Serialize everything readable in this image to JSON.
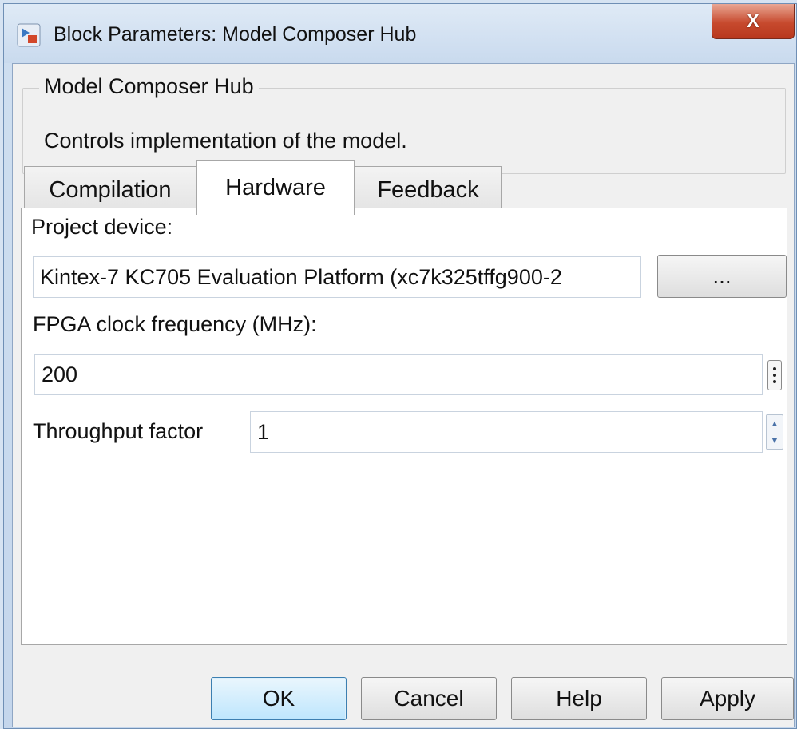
{
  "window": {
    "title": "Block Parameters: Model Composer Hub",
    "close_label": "X"
  },
  "group": {
    "legend": "Model Composer Hub",
    "description": "Controls implementation of the model."
  },
  "tabs": [
    {
      "label": "Compilation",
      "active": false
    },
    {
      "label": "Hardware",
      "active": true
    },
    {
      "label": "Feedback",
      "active": false
    }
  ],
  "hardware": {
    "project_device_label": "Project device:",
    "project_device_value": "Kintex-7 KC705 Evaluation Platform (xc7k325tffg900-2",
    "browse_label": "...",
    "clock_label": "FPGA clock frequency (MHz):",
    "clock_value": "200",
    "throughput_label": "Throughput factor",
    "throughput_value": "1"
  },
  "buttons": {
    "ok": "OK",
    "cancel": "Cancel",
    "help": "Help",
    "apply": "Apply"
  },
  "colors": {
    "close_button": "#c74a2e",
    "default_button_border": "#3c7fb1",
    "window_frame": "#c4d6ec"
  }
}
